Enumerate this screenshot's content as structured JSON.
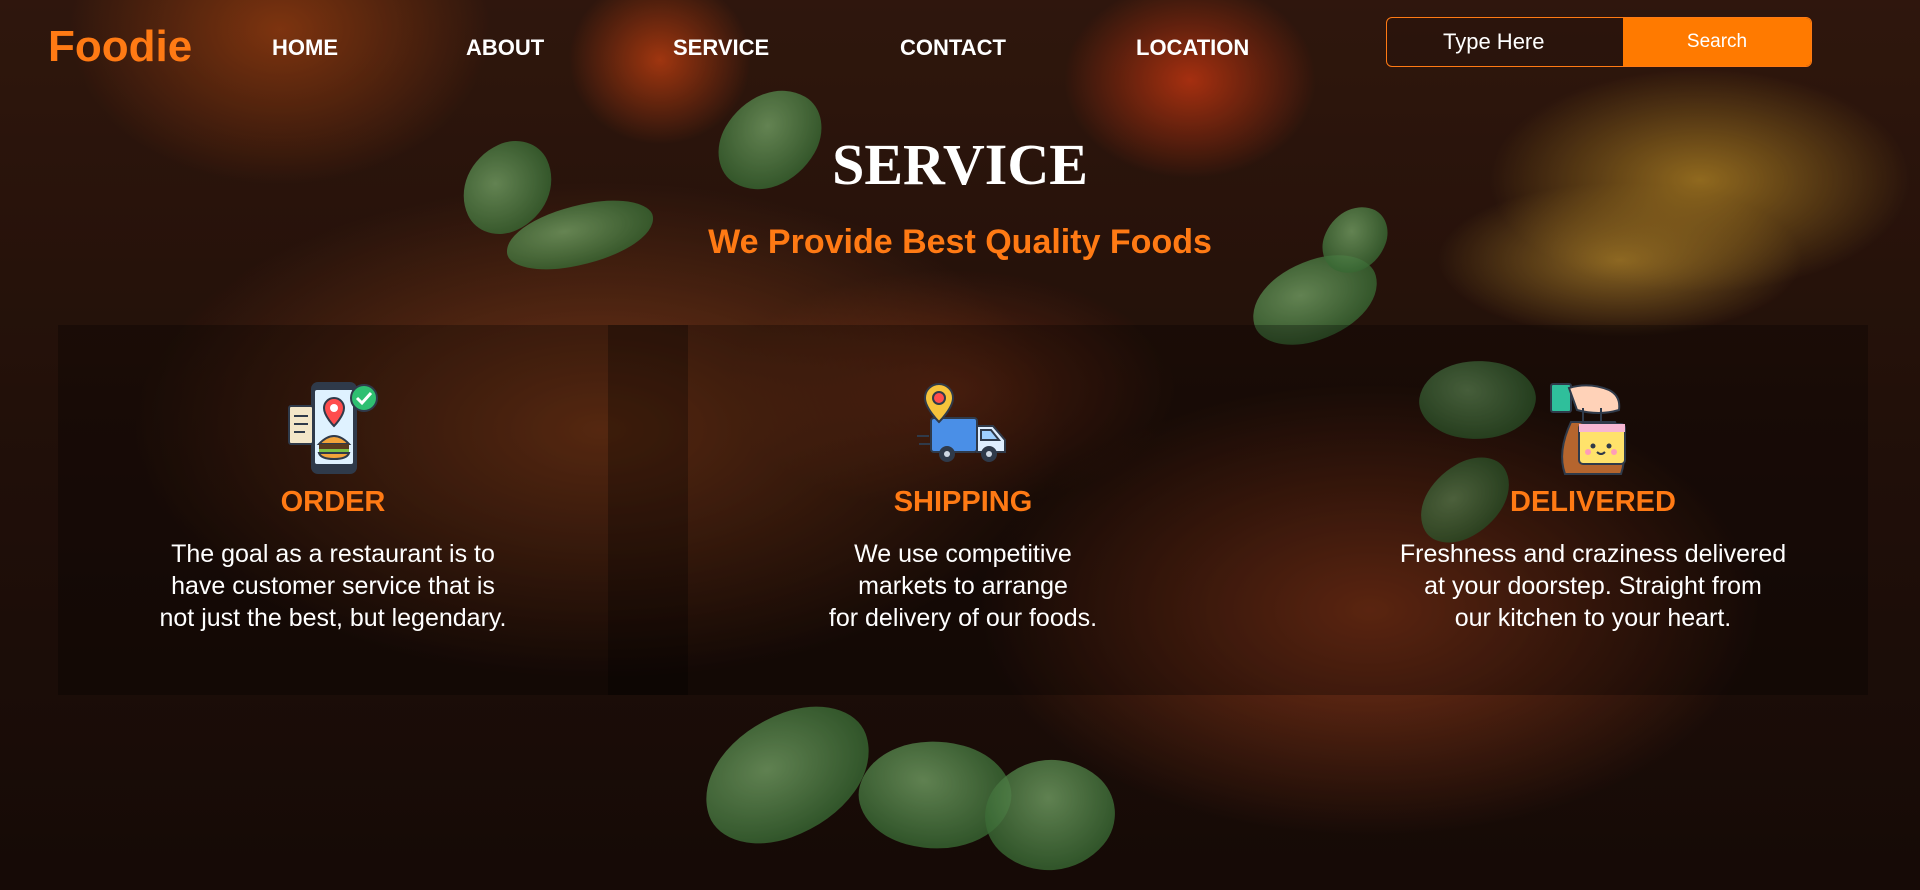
{
  "navbar": {
    "brand": "Foodie",
    "links": [
      "HOME",
      "ABOUT",
      "SERVICE",
      "CONTACT",
      "LOCATION"
    ],
    "search": {
      "placeholder": "Type Here",
      "button_label": "Search"
    }
  },
  "section": {
    "title": "SERVICE",
    "subtitle": "We Provide Best Quality Foods"
  },
  "services": [
    {
      "icon": "food-order-phone-icon",
      "title": "ORDER",
      "text": "The goal as a restaurant is to\nhave customer service that is\nnot just the best, but legendary."
    },
    {
      "icon": "delivery-truck-icon",
      "title": "SHIPPING",
      "text": "We use competitive\nmarkets to arrange\nfor delivery of our foods."
    },
    {
      "icon": "food-bag-hand-icon",
      "title": "DELIVERED",
      "text": "Freshness and craziness delivered\nat your doorstep. Straight from\nour kitchen to your heart."
    }
  ],
  "colors": {
    "accent": "#ff7a14",
    "button": "#ff7a00",
    "text": "#ffffff"
  }
}
